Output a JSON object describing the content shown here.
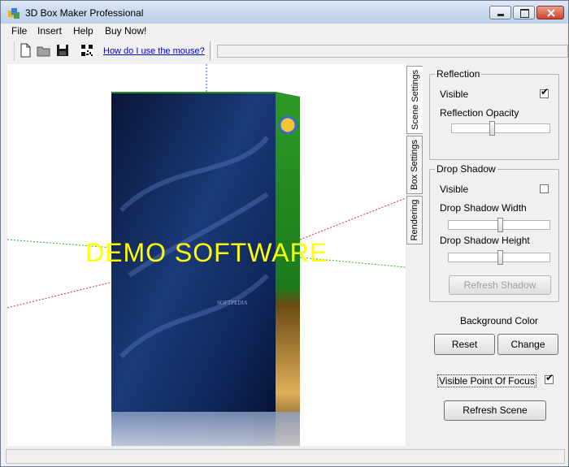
{
  "window": {
    "title": "3D Box Maker Professional"
  },
  "menu": {
    "items": [
      "File",
      "Insert",
      "Help",
      "Buy Now!"
    ]
  },
  "toolbar": {
    "help_link": "How do I use the mouse?"
  },
  "viewport": {
    "watermark": "DEMO SOFTWARE",
    "box_label": "SOFTPEDIA"
  },
  "tabs": [
    "Scene Settings",
    "Box Settings",
    "Rendering"
  ],
  "reflection": {
    "title": "Reflection",
    "visible_label": "Visible",
    "visible_checked": true,
    "opacity_label": "Reflection Opacity",
    "opacity_level": 0.5
  },
  "drop_shadow": {
    "title": "Drop Shadow",
    "visible_label": "Visible",
    "visible_checked": false,
    "width_label": "Drop Shadow Width",
    "width_level": 0.5,
    "height_label": "Drop Shadow Height",
    "height_level": 0.5,
    "refresh_label": "Refresh Shadow"
  },
  "background": {
    "label": "Background Color",
    "reset_label": "Reset",
    "change_label": "Change"
  },
  "focus": {
    "label": "Visible Point Of Focus",
    "checked": true
  },
  "refresh_scene_label": "Refresh Scene",
  "colors": {
    "watermark": "#ffff00",
    "box_front": "#0f1f4a",
    "box_side_green": "#1f8f1f",
    "link": "#0000cc"
  }
}
